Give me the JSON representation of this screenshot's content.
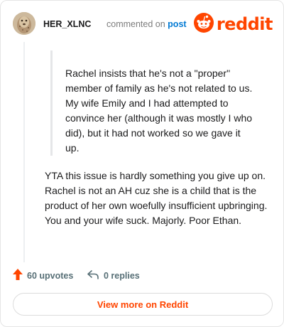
{
  "header": {
    "username": "HER_XLNC",
    "commented_text": "commented on",
    "post_link": "post",
    "brand": "reddit"
  },
  "comment": {
    "quote": "Rachel insists that he's not a \"proper\" member of family as he's not related to us. My wife Emily and I had attempted to convince her (although it was mostly I who did), but it had not worked so we gave it up.",
    "body": "YTA this issue is hardly something you give up on. Rachel is not an AH cuz she is a child that is the product of her own woefully insufficient upbringing. You and your wife suck. Majorly. Poor Ethan."
  },
  "actions": {
    "upvotes": "60 upvotes",
    "replies": "0 replies"
  },
  "footer": {
    "view_more": "View more on Reddit"
  },
  "colors": {
    "brand": "#ff4500",
    "link": "#0079d3",
    "muted": "#576f76"
  },
  "icons": {
    "avatar": "user-avatar",
    "logo": "reddit-snoo-icon",
    "upvote": "upvote-arrow-icon",
    "reply": "reply-arrow-icon"
  }
}
